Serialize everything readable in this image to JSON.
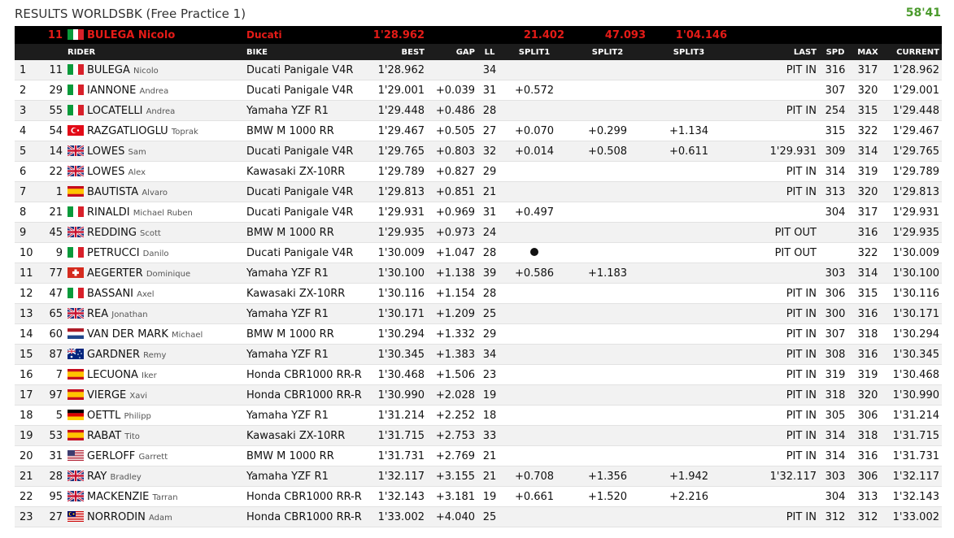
{
  "header": {
    "title": "RESULTS WORLDSBK (Free Practice 1)",
    "timer": "58'41"
  },
  "leader": {
    "number": "11",
    "flag": "IT",
    "name": "BULEGA Nicolo",
    "bike": "Ducati",
    "best": "1'28.962",
    "split1": "21.402",
    "split2": "47.093",
    "split3": "1'04.146"
  },
  "columns": {
    "rider": "RIDER",
    "bike": "BIKE",
    "best": "BEST",
    "gap": "GAP",
    "ll": "LL",
    "split1": "SPLIT1",
    "split2": "SPLIT2",
    "split3": "SPLIT3",
    "last": "LAST",
    "spd": "SPD",
    "max": "MAX",
    "current": "CURRENT"
  },
  "rows": [
    {
      "pos": "1",
      "num": "11",
      "flag": "IT",
      "last_name": "BULEGA",
      "first_name": "Nicolo",
      "bike": "Ducati Panigale V4R",
      "best": "1'28.962",
      "gap": "",
      "ll": "34",
      "s1": "",
      "s2": "",
      "s3": "",
      "last": "PIT IN",
      "spd": "316",
      "max": "317",
      "current": "1'28.962"
    },
    {
      "pos": "2",
      "num": "29",
      "flag": "IT",
      "last_name": "IANNONE",
      "first_name": "Andrea",
      "bike": "Ducati Panigale V4R",
      "best": "1'29.001",
      "gap": "+0.039",
      "ll": "31",
      "s1": "+0.572",
      "s2": "",
      "s3": "",
      "last": "",
      "spd": "307",
      "max": "320",
      "current": "1'29.001"
    },
    {
      "pos": "3",
      "num": "55",
      "flag": "IT",
      "last_name": "LOCATELLI",
      "first_name": "Andrea",
      "bike": "Yamaha YZF R1",
      "best": "1'29.448",
      "gap": "+0.486",
      "ll": "28",
      "s1": "",
      "s2": "",
      "s3": "",
      "last": "PIT IN",
      "spd": "254",
      "max": "315",
      "current": "1'29.448"
    },
    {
      "pos": "4",
      "num": "54",
      "flag": "TR",
      "last_name": "RAZGATLIOGLU",
      "first_name": "Toprak",
      "bike": "BMW M 1000 RR",
      "best": "1'29.467",
      "gap": "+0.505",
      "ll": "27",
      "s1": "+0.070",
      "s1_color": "orange",
      "s2": "+0.299",
      "s3": "+1.134",
      "last": "",
      "spd": "315",
      "max": "322",
      "current": "1'29.467"
    },
    {
      "pos": "5",
      "num": "14",
      "flag": "GB",
      "last_name": "LOWES",
      "first_name": "Sam",
      "bike": "Ducati Panigale V4R",
      "best": "1'29.765",
      "gap": "+0.803",
      "ll": "32",
      "s1": "+0.014",
      "s1_color": "orange",
      "s2": "+0.508",
      "s3": "+0.611",
      "last": "1'29.931",
      "spd": "309",
      "max": "314",
      "current": "1'29.765"
    },
    {
      "pos": "6",
      "num": "22",
      "flag": "GB",
      "last_name": "LOWES",
      "first_name": "Alex",
      "bike": "Kawasaki ZX-10RR",
      "best": "1'29.789",
      "gap": "+0.827",
      "ll": "29",
      "s1": "",
      "s2": "",
      "s3": "",
      "last": "PIT IN",
      "spd": "314",
      "max": "319",
      "current": "1'29.789"
    },
    {
      "pos": "7",
      "num": "1",
      "flag": "ES",
      "last_name": "BAUTISTA",
      "first_name": "Alvaro",
      "bike": "Ducati Panigale V4R",
      "best": "1'29.813",
      "gap": "+0.851",
      "ll": "21",
      "s1": "",
      "s2": "",
      "s3": "",
      "last": "PIT IN",
      "spd": "313",
      "max": "320",
      "current": "1'29.813"
    },
    {
      "pos": "8",
      "num": "21",
      "flag": "IT",
      "last_name": "RINALDI",
      "first_name": "Michael Ruben",
      "bike": "Ducati Panigale V4R",
      "best": "1'29.931",
      "gap": "+0.969",
      "ll": "31",
      "s1": "+0.497",
      "s2": "",
      "s3": "",
      "last": "",
      "spd": "304",
      "max": "317",
      "current": "1'29.931"
    },
    {
      "pos": "9",
      "num": "45",
      "flag": "GB",
      "last_name": "REDDING",
      "first_name": "Scott",
      "bike": "BMW M 1000 RR",
      "best": "1'29.935",
      "gap": "+0.973",
      "ll": "24",
      "s1": "",
      "s2": "",
      "s3": "",
      "last": "PIT OUT",
      "spd": "",
      "max": "316",
      "current": "1'29.935"
    },
    {
      "pos": "10",
      "num": "9",
      "flag": "IT",
      "last_name": "PETRUCCI",
      "first_name": "Danilo",
      "bike": "Ducati Panigale V4R",
      "best": "1'30.009",
      "gap": "+1.047",
      "ll": "28",
      "s1": "●",
      "s2": "",
      "s3": "",
      "last": "PIT OUT",
      "spd": "",
      "max": "322",
      "current": "1'30.009"
    },
    {
      "pos": "11",
      "num": "77",
      "flag": "CH",
      "last_name": "AEGERTER",
      "first_name": "Dominique",
      "bike": "Yamaha YZF R1",
      "best": "1'30.100",
      "gap": "+1.138",
      "ll": "39",
      "s1": "+0.586",
      "s2": "+1.183",
      "s3": "",
      "last": "",
      "spd": "303",
      "max": "314",
      "current": "1'30.100"
    },
    {
      "pos": "12",
      "num": "47",
      "flag": "IT",
      "last_name": "BASSANI",
      "first_name": "Axel",
      "bike": "Kawasaki ZX-10RR",
      "best": "1'30.116",
      "gap": "+1.154",
      "ll": "28",
      "s1": "",
      "s2": "",
      "s3": "",
      "last": "PIT IN",
      "spd": "306",
      "max": "315",
      "current": "1'30.116"
    },
    {
      "pos": "13",
      "num": "65",
      "flag": "GB",
      "last_name": "REA",
      "first_name": "Jonathan",
      "bike": "Yamaha YZF R1",
      "best": "1'30.171",
      "gap": "+1.209",
      "ll": "25",
      "s1": "",
      "s2": "",
      "s3": "",
      "last": "PIT IN",
      "spd": "300",
      "max": "316",
      "current": "1'30.171"
    },
    {
      "pos": "14",
      "num": "60",
      "flag": "NL",
      "last_name": "VAN DER MARK",
      "first_name": "Michael",
      "bike": "BMW M 1000 RR",
      "best": "1'30.294",
      "gap": "+1.332",
      "ll": "29",
      "s1": "",
      "s2": "",
      "s3": "",
      "last": "PIT IN",
      "spd": "307",
      "max": "318",
      "current": "1'30.294"
    },
    {
      "pos": "15",
      "num": "87",
      "flag": "AU",
      "last_name": "GARDNER",
      "first_name": "Remy",
      "bike": "Yamaha YZF R1",
      "best": "1'30.345",
      "gap": "+1.383",
      "ll": "34",
      "s1": "",
      "s2": "",
      "s3": "",
      "last": "PIT IN",
      "spd": "308",
      "max": "316",
      "current": "1'30.345"
    },
    {
      "pos": "16",
      "num": "7",
      "flag": "ES",
      "last_name": "LECUONA",
      "first_name": "Iker",
      "bike": "Honda CBR1000 RR-R",
      "best": "1'30.468",
      "gap": "+1.506",
      "ll": "23",
      "s1": "",
      "s2": "",
      "s3": "",
      "last": "PIT IN",
      "spd": "319",
      "spd_color": "orange",
      "max": "319",
      "current": "1'30.468"
    },
    {
      "pos": "17",
      "num": "97",
      "flag": "ES",
      "last_name": "VIERGE",
      "first_name": "Xavi",
      "bike": "Honda CBR1000 RR-R",
      "best": "1'30.990",
      "gap": "+2.028",
      "ll": "19",
      "s1": "",
      "s2": "",
      "s3": "",
      "last": "PIT IN",
      "spd": "318",
      "max": "320",
      "current": "1'30.990"
    },
    {
      "pos": "18",
      "num": "5",
      "flag": "DE",
      "last_name": "OETTL",
      "first_name": "Philipp",
      "bike": "Yamaha YZF R1",
      "best": "1'31.214",
      "gap": "+2.252",
      "ll": "18",
      "s1": "",
      "s2": "",
      "s3": "",
      "last": "PIT IN",
      "spd": "305",
      "max": "306",
      "current": "1'31.214"
    },
    {
      "pos": "19",
      "num": "53",
      "flag": "ES",
      "last_name": "RABAT",
      "first_name": "Tito",
      "bike": "Kawasaki ZX-10RR",
      "best": "1'31.715",
      "gap": "+2.753",
      "ll": "33",
      "s1": "",
      "s2": "",
      "s3": "",
      "last": "PIT IN",
      "spd": "314",
      "max": "318",
      "current": "1'31.715"
    },
    {
      "pos": "20",
      "num": "31",
      "flag": "US",
      "last_name": "GERLOFF",
      "first_name": "Garrett",
      "bike": "BMW M 1000 RR",
      "best": "1'31.731",
      "gap": "+2.769",
      "ll": "21",
      "s1": "",
      "s2": "",
      "s3": "",
      "last": "PIT IN",
      "spd": "314",
      "max": "316",
      "current": "1'31.731"
    },
    {
      "pos": "21",
      "pos_color": "red",
      "num": "28",
      "flag": "GB",
      "last_name": "RAY",
      "first_name": "Bradley",
      "bike": "Yamaha YZF R1",
      "best": "1'32.117",
      "gap": "+3.155",
      "ll": "21",
      "s1": "+0.708",
      "s1_color": "orange",
      "s2": "+1.356",
      "s2_color": "orange",
      "s3": "+1.942",
      "s3_color": "orange",
      "last": "1'32.117",
      "last_color": "orange",
      "spd": "303",
      "max": "306",
      "current": "1'32.117"
    },
    {
      "pos": "22",
      "num": "95",
      "flag": "GB",
      "last_name": "MACKENZIE",
      "first_name": "Tarran",
      "bike": "Honda CBR1000 RR-R",
      "best": "1'32.143",
      "gap": "+3.181",
      "ll": "19",
      "s1": "+0.661",
      "s2": "+1.520",
      "s2_color": "orange",
      "s3": "+2.216",
      "s3_color": "orange",
      "last": "",
      "spd": "304",
      "max": "313",
      "current": "1'32.143"
    },
    {
      "pos": "23",
      "num": "27",
      "flag": "MY",
      "last_name": "NORRODIN",
      "first_name": "Adam",
      "bike": "Honda CBR1000 RR-R",
      "best": "1'33.002",
      "gap": "+4.040",
      "ll": "25",
      "s1": "",
      "s2": "",
      "s3": "",
      "last": "PIT IN",
      "spd": "312",
      "spd_color": "orange",
      "max": "312",
      "current": "1'33.002"
    }
  ]
}
